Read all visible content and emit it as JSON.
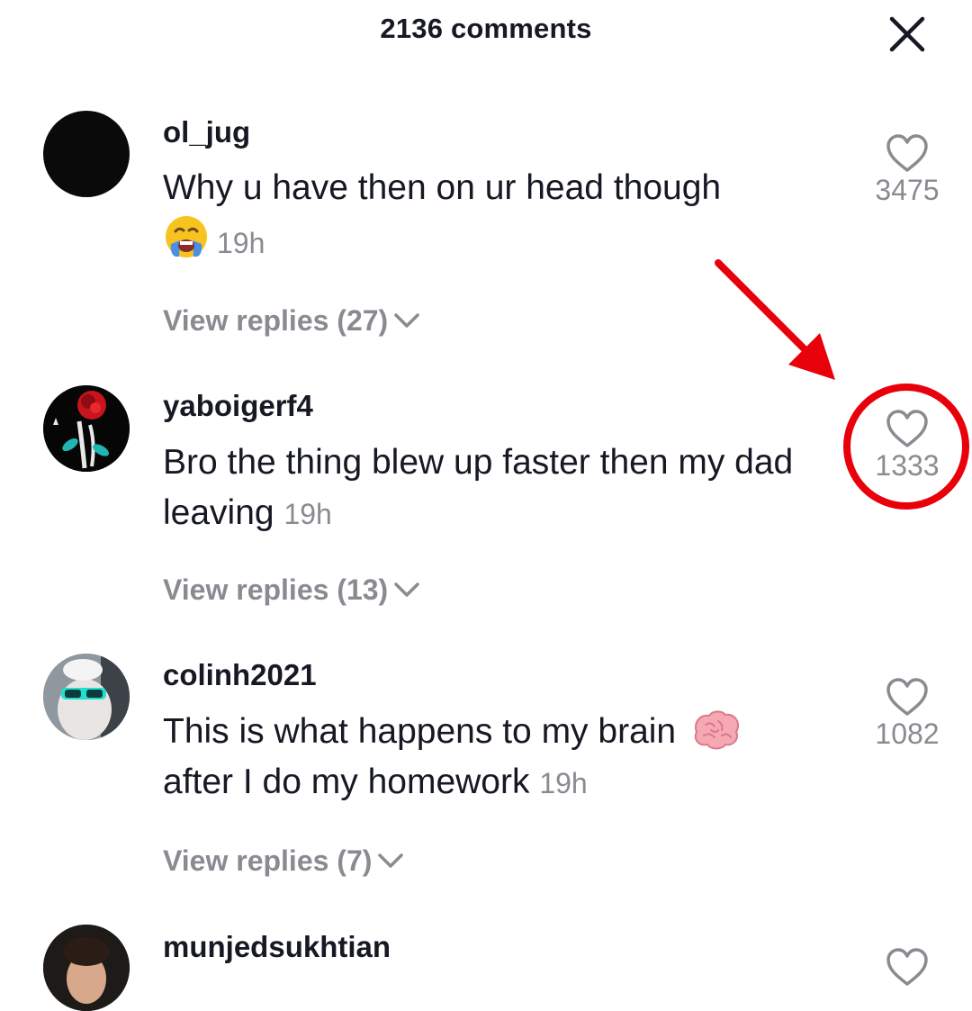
{
  "header": {
    "title": "2136 comments",
    "close_icon": "close-icon"
  },
  "comments": [
    {
      "username": "ol_jug",
      "text": "Why u have then on ur head though",
      "emoji": "crying-face",
      "time": "19h",
      "likes": "3475",
      "view_replies": "View replies (27)"
    },
    {
      "username": "yaboigerf4",
      "text": "Bro the thing blew up faster then my dad leaving",
      "time": "19h",
      "likes": "1333",
      "view_replies": "View replies (13)"
    },
    {
      "username": "colinh2021",
      "text": "This is what happens to my brain",
      "emoji": "brain",
      "text2": "after I do my homework",
      "time": "19h",
      "likes": "1082",
      "view_replies": "View replies (7)"
    },
    {
      "username": "munjedsukhtian"
    }
  ],
  "colors": {
    "text_primary": "#161823",
    "text_secondary": "#8a8b91",
    "annotation_red": "#e8000b"
  }
}
